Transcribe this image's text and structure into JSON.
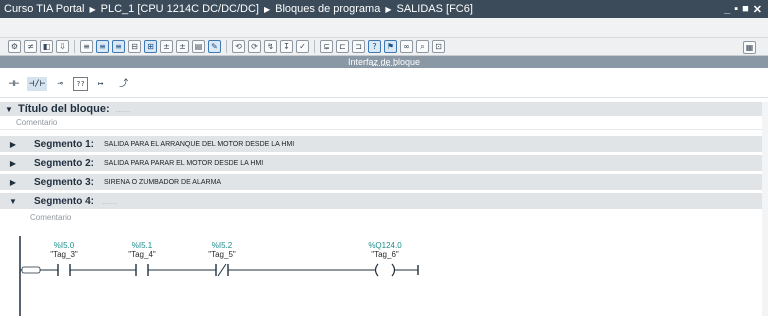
{
  "titlebar": {
    "crumbs": [
      "Curso TIA Portal",
      "PLC_1 [CPU 1214C DC/DC/DC]",
      "Bloques de programa",
      "SALIDAS [FC6]"
    ],
    "controls": [
      "_",
      "▪",
      "■",
      "✕"
    ]
  },
  "toolbar": {
    "icons": [
      "compile-icon",
      "compare-icon",
      "monitor-icon",
      "download-icon",
      "network-icon",
      "insert-network-icon",
      "delete-network-icon",
      "expand-icon",
      "collapse-icon",
      "display-icon",
      "absolute-operands-icon",
      "favorites-icon",
      "comments-icon",
      "go-to-icon",
      "set-icon",
      "reset-icon",
      "jump-icon",
      "next-error-icon",
      "prev-error-icon",
      "select-icon",
      "monitor-on-off-icon",
      "help-icon"
    ]
  },
  "interface_bar": {
    "label": "Interfaz de bloque"
  },
  "favorites": {
    "items": [
      {
        "symbol": "⊣⊢",
        "name": "no-contact"
      },
      {
        "symbol": "⊣/⊢",
        "name": "nc-contact"
      },
      {
        "symbol": "⊸",
        "name": "coil"
      },
      {
        "symbol": "??",
        "name": "empty-box"
      },
      {
        "symbol": "↦",
        "name": "open-branch"
      },
      {
        "symbol": "⤴",
        "name": "close-branch"
      }
    ]
  },
  "block": {
    "title_label": "Título del bloque:",
    "title_value": "......",
    "comment": "Comentario"
  },
  "segments": [
    {
      "label": "Segmento 1:",
      "desc": "SALIDA PARA EL ARRANQUE DEL MOTOR DESDE LA HMI",
      "expanded": false
    },
    {
      "label": "Segmento 2:",
      "desc": "SALIDA PARA PARAR EL MOTOR DESDE LA HMI",
      "expanded": false
    },
    {
      "label": "Segmento 3:",
      "desc": "SIRENA O ZUMBADOR DE ALARMA",
      "expanded": false
    },
    {
      "label": "Segmento 4:",
      "desc": "......",
      "expanded": true
    }
  ],
  "segment4": {
    "comment": "Comentario",
    "contacts": [
      {
        "addr": "%I5.0",
        "tag": "\"Tag_3\"",
        "type": "NO"
      },
      {
        "addr": "%I5.1",
        "tag": "\"Tag_4\"",
        "type": "NO"
      },
      {
        "addr": "%I5.2",
        "tag": "\"Tag_5\"",
        "type": "NC"
      }
    ],
    "coil": {
      "addr": "%Q124.0",
      "tag": "\"Tag_6\""
    }
  },
  "colors": {
    "titlebar": "#3b4b5a",
    "segment_bg": "#e1e4e7",
    "operand": "#1a8f8a",
    "selected_bg": "#d6e3ee"
  }
}
